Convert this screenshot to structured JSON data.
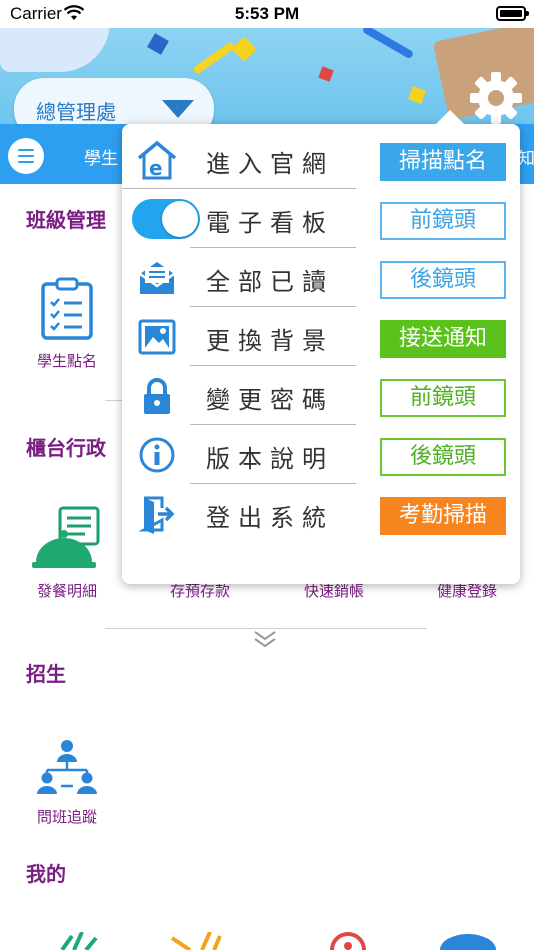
{
  "status_bar": {
    "carrier": "Carrier",
    "time": "5:53 PM"
  },
  "header": {
    "campus_select": "總管理處"
  },
  "nav_strip": {
    "left_tab": "學生",
    "right_tab": "知"
  },
  "sections": [
    {
      "title": "班級管理",
      "items": [
        {
          "label": "學生點名",
          "icon": "clipboard-check-icon"
        }
      ]
    },
    {
      "title": "櫃台行政",
      "items": [
        {
          "label": "發餐明細",
          "icon": "meal-bell-icon"
        },
        {
          "label": "存預存款",
          "icon": "deposit-icon"
        },
        {
          "label": "快速銷帳",
          "icon": "quick-writeoff-icon"
        },
        {
          "label": "健康登錄",
          "icon": "health-record-icon"
        }
      ]
    },
    {
      "title": "招生",
      "items": [
        {
          "label": "問班追蹤",
          "icon": "class-tracking-icon"
        }
      ]
    },
    {
      "title": "我的",
      "items": []
    }
  ],
  "menu": [
    {
      "label": "進入官網",
      "icon": "home-web-icon",
      "tag": "掃描點名",
      "tag_style": "fill-blue"
    },
    {
      "label": "電子看板",
      "icon": "toggle-switch",
      "tag": "前鏡頭",
      "tag_style": "out-blue"
    },
    {
      "label": "全部已讀",
      "icon": "mail-read-icon",
      "tag": "後鏡頭",
      "tag_style": "out-blue"
    },
    {
      "label": "更換背景",
      "icon": "image-icon",
      "tag": "接送通知",
      "tag_style": "fill-green"
    },
    {
      "label": "變更密碼",
      "icon": "lock-icon",
      "tag": "前鏡頭",
      "tag_style": "out-green"
    },
    {
      "label": "版本說明",
      "icon": "info-icon",
      "tag": "後鏡頭",
      "tag_style": "out-green"
    },
    {
      "label": "登出系統",
      "icon": "logout-door-icon",
      "tag": "考勤掃描",
      "tag_style": "fill-orange"
    }
  ],
  "colors": {
    "accent_blue": "#2e9ff0",
    "section_purple": "#7a1f83",
    "green": "#5bc11b",
    "orange": "#f68520"
  }
}
